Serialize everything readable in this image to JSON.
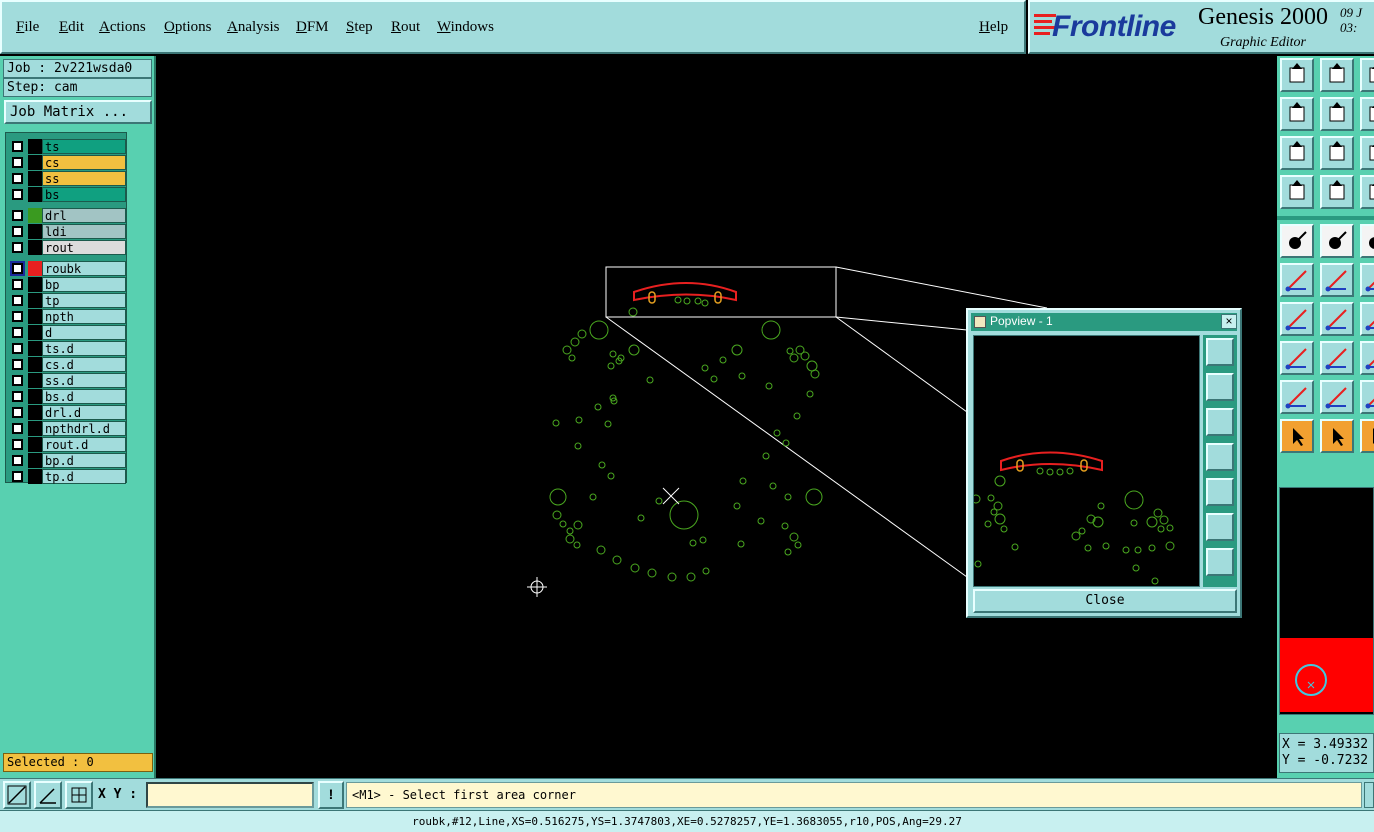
{
  "menubar": {
    "items": [
      "File",
      "Edit",
      "Actions",
      "Options",
      "Analysis",
      "DFM",
      "Step",
      "Rout",
      "Windows"
    ],
    "help": "Help"
  },
  "logo": {
    "brand": "Frontline",
    "product": "Genesis 2000",
    "subtitle": "Graphic Editor",
    "date_line1": "09 J",
    "date_line2": "03:"
  },
  "job": {
    "job_label": "Job : 2v221wsda0",
    "step_label": "Step: cam",
    "matrix_button": "Job Matrix ..."
  },
  "layers": [
    {
      "name": "ts",
      "name_color": "#10a080",
      "swatch": "#000000"
    },
    {
      "name": "cs",
      "name_color": "#f2c040",
      "swatch": "#000000"
    },
    {
      "name": "ss",
      "name_color": "#f2c040",
      "swatch": "#000000"
    },
    {
      "name": "bs",
      "name_color": "#10a080",
      "swatch": "#000000"
    },
    {
      "name": "drl",
      "name_color": "#a2c4c4",
      "swatch": "#3a9a20"
    },
    {
      "name": "ldi",
      "name_color": "#a2c4c4",
      "swatch": "#000000"
    },
    {
      "name": "rout",
      "name_color": "#dcdcdc",
      "swatch": "#000000"
    },
    {
      "name": "roubk",
      "name_color": "#a2dcdc",
      "swatch": "#e82020",
      "active": true
    },
    {
      "name": "bp",
      "name_color": "#a2dcdc",
      "swatch": "#000000"
    },
    {
      "name": "tp",
      "name_color": "#a2dcdc",
      "swatch": "#000000"
    },
    {
      "name": "npth",
      "name_color": "#a2dcdc",
      "swatch": "#000000"
    },
    {
      "name": "d",
      "name_color": "#a2dcdc",
      "swatch": "#000000"
    },
    {
      "name": "ts.d",
      "name_color": "#a2dcdc",
      "swatch": "#000000"
    },
    {
      "name": "cs.d",
      "name_color": "#a2dcdc",
      "swatch": "#000000"
    },
    {
      "name": "ss.d",
      "name_color": "#a2dcdc",
      "swatch": "#000000"
    },
    {
      "name": "bs.d",
      "name_color": "#a2dcdc",
      "swatch": "#000000"
    },
    {
      "name": "drl.d",
      "name_color": "#a2dcdc",
      "swatch": "#000000"
    },
    {
      "name": "npthdrl.d",
      "name_color": "#a2dcdc",
      "swatch": "#000000"
    },
    {
      "name": "rout.d",
      "name_color": "#a2dcdc",
      "swatch": "#000000"
    },
    {
      "name": "bp.d",
      "name_color": "#a2dcdc",
      "swatch": "#000000"
    },
    {
      "name": "tp.d",
      "name_color": "#a2dcdc",
      "swatch": "#000000"
    }
  ],
  "selected": "Selected : 0",
  "popview": {
    "title": "Popview - 1",
    "close_x": "×",
    "close_button": "Close"
  },
  "coords": {
    "x": "X = 3.49332",
    "y": "Y = -0.7232"
  },
  "bottom": {
    "xy_label": "X Y :",
    "xy_value": "",
    "exclaim": "!",
    "message": "<M1> - Select first area corner"
  },
  "status": "roubk,#12,Line,XS=0.516275,YS=1.3747803,XE=0.5278257,YE=1.3683055,r10,POS,Ang=29.27",
  "colors": {
    "panel": "#a2dcdc",
    "panel_dark": "#58d0b0",
    "pad": "#4aa820",
    "rout": "#e82020",
    "drill": "#e6a020"
  }
}
